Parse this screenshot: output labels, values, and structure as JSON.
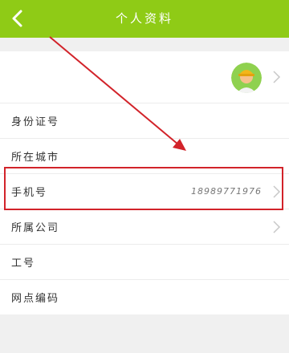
{
  "nav": {
    "title": "个人资料",
    "back_icon": "chevron-left-icon",
    "bar_color": "#8fcb16"
  },
  "profile": {
    "avatar_icon": "worker-avatar-icon",
    "rows": [
      {
        "label": "身份证号",
        "value": ""
      },
      {
        "label": "所在城市",
        "value": ""
      },
      {
        "label": "手机号",
        "value": "18989771976"
      },
      {
        "label": "所属公司",
        "value": ""
      },
      {
        "label": "工号",
        "value": ""
      },
      {
        "label": "网点编码",
        "value": ""
      }
    ]
  },
  "annotation": {
    "color": "#d2232a",
    "target": "手机号"
  }
}
